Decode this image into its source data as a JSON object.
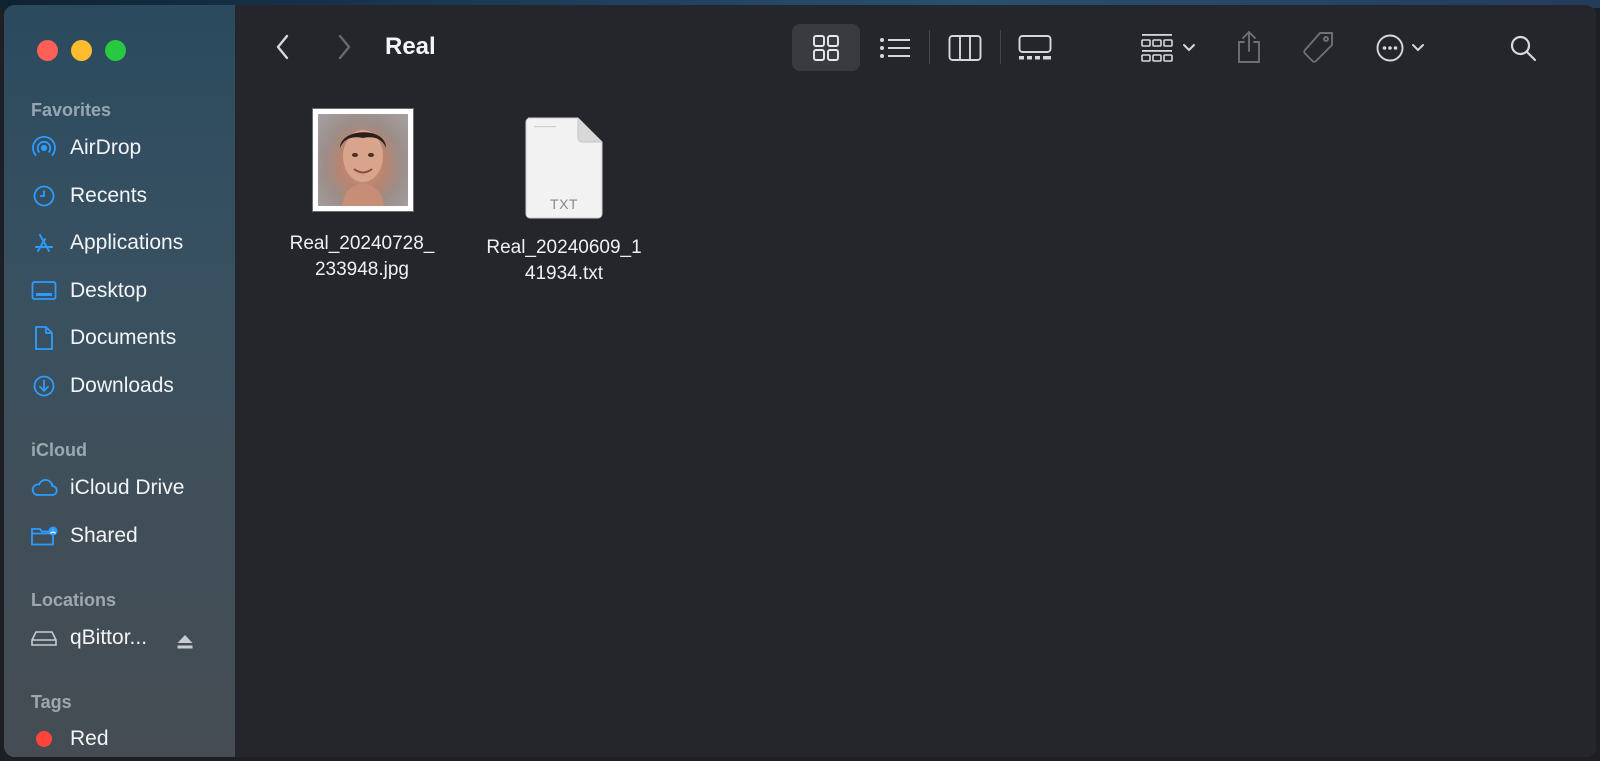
{
  "window": {
    "title": "Real"
  },
  "sidebar": {
    "sections": [
      {
        "title": "Favorites"
      },
      {
        "title": "iCloud"
      },
      {
        "title": "Locations"
      },
      {
        "title": "Tags"
      }
    ],
    "favorites": [
      {
        "label": "AirDrop",
        "icon": "airdrop-icon"
      },
      {
        "label": "Recents",
        "icon": "clock-icon"
      },
      {
        "label": "Applications",
        "icon": "applications-icon"
      },
      {
        "label": "Desktop",
        "icon": "desktop-icon"
      },
      {
        "label": "Documents",
        "icon": "document-icon"
      },
      {
        "label": "Downloads",
        "icon": "download-icon"
      }
    ],
    "icloud": [
      {
        "label": "iCloud Drive",
        "icon": "cloud-icon"
      },
      {
        "label": "Shared",
        "icon": "shared-folder-icon"
      }
    ],
    "locations": [
      {
        "label": "qBittor...",
        "icon": "drive-icon"
      }
    ],
    "tags": [
      {
        "label": "Red",
        "color": "#ff453a"
      }
    ]
  },
  "files": [
    {
      "name_line1": "Real_20240728_",
      "name_line2": "233948.jpg",
      "kind": "image"
    },
    {
      "name_line1": "Real_20240609_1",
      "name_line2": "41934.txt",
      "kind": "text",
      "badge": "TXT"
    }
  ],
  "colors": {
    "accent": "#0a84ff",
    "background": "#25262b"
  }
}
